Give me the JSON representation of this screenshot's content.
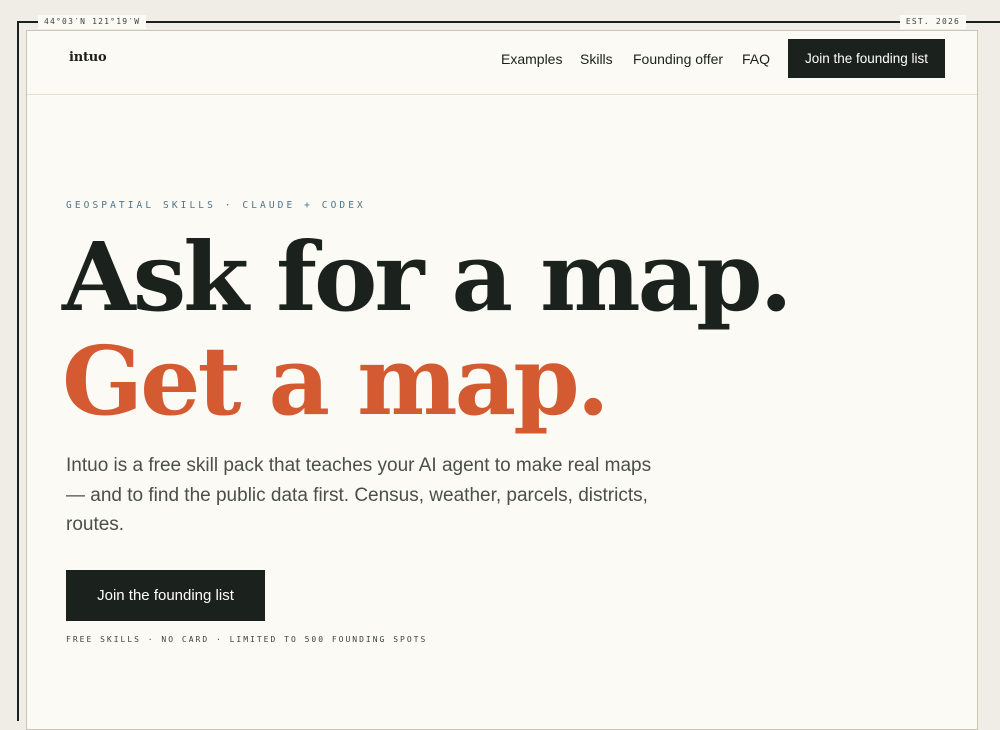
{
  "frame": {
    "coordinates": "44°03′N  121°19′W",
    "established": "EST. 2026"
  },
  "header": {
    "logo": "intuo",
    "nav": [
      {
        "label": "Examples"
      },
      {
        "label": "Skills"
      },
      {
        "label": "Founding offer"
      },
      {
        "label": "FAQ"
      }
    ],
    "cta_label": "Join the founding list"
  },
  "hero": {
    "eyebrow": "GEOSPATIAL SKILLS · CLAUDE + CODEX",
    "headline_line1": "Ask for a map.",
    "headline_line2": "Get a map.",
    "lead": "Intuo is a free skill pack that teaches your AI agent to make real maps — and to find the public data first. Census, weather, parcels, districts, routes.",
    "cta_label": "Join the founding list",
    "fineprint": "FREE SKILLS · NO CARD · LIMITED TO 500 FOUNDING SPOTS"
  },
  "colors": {
    "ink": "#1b211c",
    "accent": "#d35a31",
    "eyebrow": "#4f7488",
    "paper": "#fbfaf5",
    "backdrop": "#efede5"
  }
}
